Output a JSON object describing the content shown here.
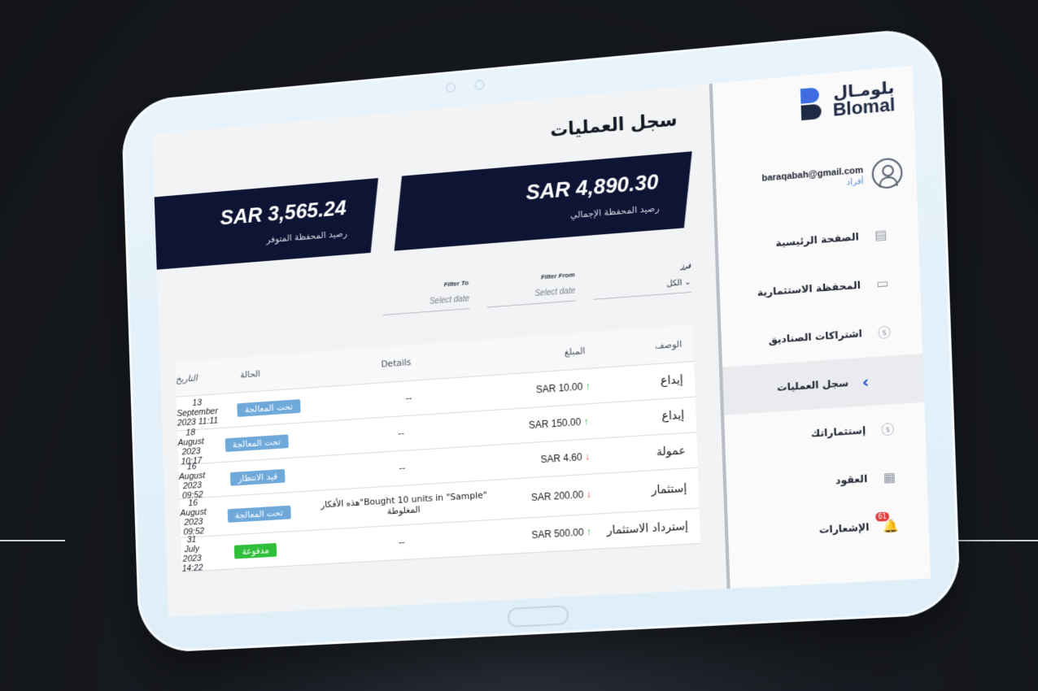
{
  "brand": {
    "name_ar": "بلومـال",
    "name_en": "Blomal"
  },
  "user": {
    "email": "baraqabah@gmail.com",
    "role": "أفراد"
  },
  "nav": [
    {
      "label": "الصفحة الرئيسية",
      "icon": "home-icon"
    },
    {
      "label": "المحفظة الاستثمارية",
      "icon": "wallet-icon"
    },
    {
      "label": "اشتراكات الصناديق",
      "icon": "dollar-icon"
    },
    {
      "label": "سجل العمليات",
      "icon": "chevron-left-icon",
      "active": true
    },
    {
      "label": "إستثماراتك",
      "icon": "dollar-icon"
    },
    {
      "label": "العقود",
      "icon": "document-icon"
    },
    {
      "label": "الإشعارات",
      "icon": "bell-icon",
      "badge": "61"
    }
  ],
  "page": {
    "title": "سجل العمليات"
  },
  "cards": {
    "total": {
      "value": "SAR 4,890.30",
      "label": "رصيد المحفظة الإجمالي"
    },
    "available": {
      "value": "SAR 3,565.24",
      "label": "رصيد المحفظة المتوفر"
    }
  },
  "filters": {
    "sort": {
      "label": "فرز",
      "value": "الكل"
    },
    "from": {
      "label": "Filter From",
      "placeholder": "Select date"
    },
    "to": {
      "label": "Filter To",
      "placeholder": "Select date"
    }
  },
  "table": {
    "headers": {
      "desc": "الوصف",
      "amount": "المبلغ",
      "details": "Details",
      "status": "الحالة",
      "date": "التاريخ"
    },
    "rows": [
      {
        "desc": "إيداع",
        "amount": "SAR 10.00",
        "dir": "↑",
        "details": "--",
        "status": "تحت المعالجة",
        "date": "13 September 2023 11:11"
      },
      {
        "desc": "إيداع",
        "amount": "SAR 150.00",
        "dir": "↑",
        "details": "--",
        "status": "تحت المعالجة",
        "date": "18 August 2023 10:17"
      },
      {
        "desc": "عمولة",
        "amount": "SAR 4.60",
        "dir": "↓",
        "details": "--",
        "status": "قيد الانتظار",
        "date": "16 August 2023 09:52"
      },
      {
        "desc": "إستثمار",
        "amount": "SAR 200.00",
        "dir": "↓",
        "details": "\"Bought 10 units in \"Sample\"هذه الأفكار المغلوطة",
        "status": "تحت المعالجة",
        "date": "16 August 2023 09:52"
      },
      {
        "desc": "إسترداد الاستثمار",
        "amount": "SAR 500.00",
        "dir": "↑",
        "details": "--",
        "status": "مدفوعة",
        "date": "31 July 2023 14:22"
      }
    ]
  }
}
